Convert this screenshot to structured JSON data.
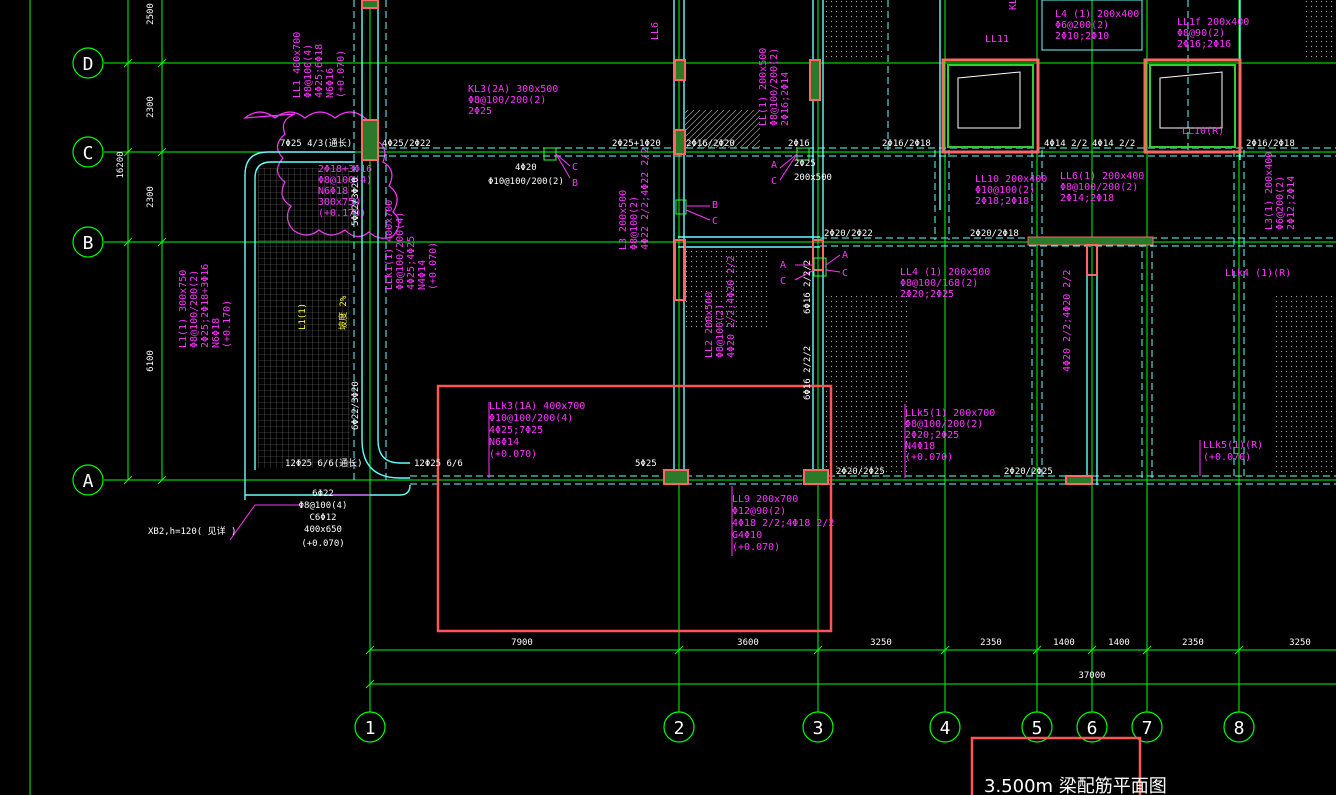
{
  "colors": {
    "background": "#000000",
    "grid_line": "#00ff00",
    "beam_text": "#ff33ff",
    "wall": "#66ffff",
    "column": "#ff6666",
    "highlight_box": "#ff5555",
    "dimension": "#00ff00"
  },
  "drawing": {
    "title": "3.500m 梁配筋平面图",
    "total_dimension": "37000"
  },
  "axes": {
    "rows": [
      {
        "label": "D"
      },
      {
        "label": "C"
      },
      {
        "label": "B"
      },
      {
        "label": "A"
      }
    ],
    "columns": [
      {
        "label": "1"
      },
      {
        "label": "2"
      },
      {
        "label": "3"
      },
      {
        "label": "4"
      },
      {
        "label": "5"
      },
      {
        "label": "6"
      },
      {
        "label": "7"
      },
      {
        "label": "8"
      }
    ],
    "left_dims": [
      "2500",
      "2300",
      "16200",
      "2300",
      "6100"
    ],
    "bottom_dims": [
      "7900",
      "3600",
      "3250",
      "2350",
      "1400",
      "1400",
      "2350",
      "3250"
    ]
  },
  "annotations": {
    "llk3": [
      "LLk3(1A) 400x700",
      "Φ10@100/200(4)",
      "4Φ25;7Φ25",
      "N6Φ14",
      "(+0.070)"
    ],
    "ll9": [
      "LL9 200x700",
      "Φ12@90(2)",
      "4Φ18 2/2;4Φ18 2/2",
      "G4Φ10",
      "(+0.070)"
    ],
    "kl3": [
      "KL3(2A) 300x500",
      "Φ8@100/200(2)",
      "2Φ25"
    ],
    "ll1_top": [
      "LL1 400x700",
      "Φ8@100(4)",
      "4Φ25;6Φ18",
      "N6Φ16",
      "(+0.070)"
    ],
    "wkl_c": [
      "2Φ18+3Φ16",
      "Φ8@100(4)",
      "N6Φ18",
      "300x750",
      "(+0.170)"
    ],
    "llk1": [
      "LLk1(1) 400x700",
      "Φ8@100/200(4)",
      "4Φ25;4Φ25",
      "N4Φ14",
      "(+0.070)"
    ],
    "l1": [
      "L1(1) 300x750",
      "Φ8@100/200(2)",
      "2Φ25;2Φ18+3Φ16",
      "N6Φ18",
      "(+0.170)"
    ],
    "l3": [
      "L3 200x500",
      "Φ8@100(2)",
      "4Φ22 2/2;4Φ22 2/2"
    ],
    "ll2": [
      "LL2 200x500",
      "Φ8@100(2)",
      "4Φ20 2/2;4Φ20 2/2"
    ],
    "ll_b": [
      "LL(1) 200x500",
      "Φ8@100/200(2)",
      "2Φ16;2Φ14"
    ],
    "ll4": [
      "LL4 (1) 200x500",
      "Φ8@100/168(2)",
      "2Φ20;2Φ25"
    ],
    "ll10": [
      "LL10 200x400",
      "Φ10@100(2)",
      "2Φ18;2Φ18"
    ],
    "ll6": [
      "LL6(1) 200x400",
      "Φ8@100/200(2)",
      "2Φ14;2Φ18"
    ],
    "ll5": [
      "LLk5(1) 200x700",
      "Φ8@100/200(2)",
      "2Φ20;2Φ25",
      "N4Φ18",
      "(+0.070)"
    ],
    "ll5_right": [
      "LLk5(1)(R)",
      "(+0.070)"
    ],
    "ll4_right": "LLk4 (1)(R)",
    "ll_top1": [
      "L4 (1) 200x400",
      "Φ6@200(2)",
      "2Φ10;2Φ10"
    ],
    "ll_top2": [
      "LL1f 200x400",
      "Φ8@90(2)",
      "2Φ16;2Φ16"
    ],
    "ll10_right": "LL10(R)",
    "l3_right": [
      "L3(1) 200x400",
      "Φ6@200(2)",
      "2Φ12;2Φ14"
    ],
    "xb2": "XB2,h=120( 见详 )",
    "base_beam": [
      "6Φ22",
      "Φ8@100(4)",
      "C6Φ12",
      "400x650",
      "(+0.070)"
    ],
    "slope_note": "坡度 2%",
    "l1_mid": "L1(1)",
    "ll_small1": "LL11",
    "ll_small2": "LL6",
    "kl_label": "KL"
  },
  "reinforcement_labels": {
    "c_row": [
      "7Φ25 4/3(通长)",
      "4Φ25/2Φ22",
      "2Φ25+1Φ20",
      "2Φ16/2Φ20",
      "2Φ16",
      "2Φ16/2Φ18",
      "4Φ14 2/2",
      "4Φ14 2/2",
      "2Φ16/2Φ18"
    ],
    "c_mid": [
      "4Φ20",
      "Φ10@100/200(2)",
      "2Φ25",
      "200x500"
    ],
    "b_row": [
      "2Φ20/2Φ22",
      "2Φ20/2Φ18"
    ],
    "a_row": [
      "12Φ25 6/6(通长)",
      "12Φ25 6/6",
      "5Φ25",
      "2Φ20/2Φ25",
      "2Φ20/2Φ25"
    ],
    "vertical": [
      "5Φ22/3Φ20",
      "6Φ22/3Φ20",
      "6Φ16 2/2/2",
      "6Φ16 2/2/2",
      "4Φ20 2/2;4Φ20 2/2"
    ],
    "section_marks": [
      "A",
      "B",
      "C"
    ]
  }
}
